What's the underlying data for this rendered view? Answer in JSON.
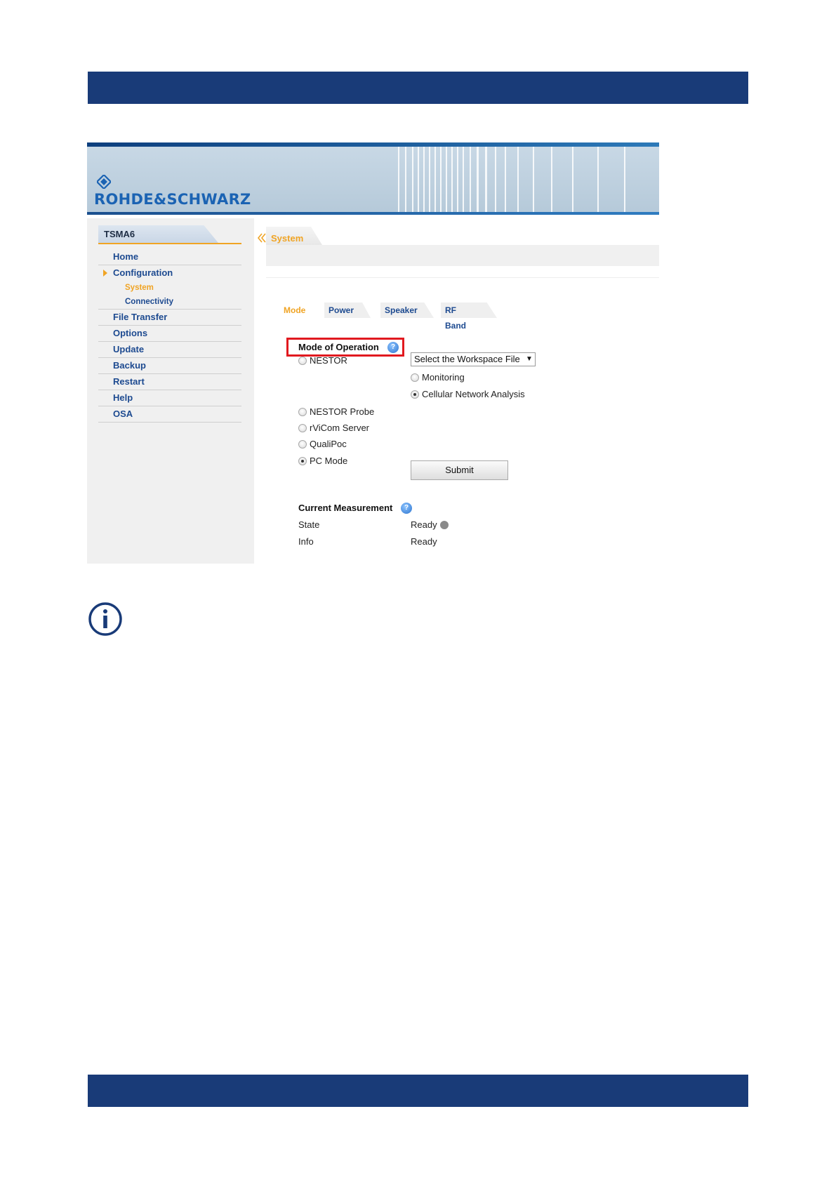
{
  "brand": {
    "logo_text": "ROHDE&SCHWARZ"
  },
  "device": {
    "name": "TSMA6"
  },
  "nav": {
    "home": "Home",
    "configuration": "Configuration",
    "system": "System",
    "connectivity": "Connectivity",
    "file_transfer": "File Transfer",
    "options": "Options",
    "update": "Update",
    "backup": "Backup",
    "restart": "Restart",
    "help": "Help",
    "osa": "OSA"
  },
  "section": {
    "title": "System"
  },
  "tabs": [
    {
      "label": "Mode",
      "active": true
    },
    {
      "label": "Power",
      "active": false
    },
    {
      "label": "Speaker",
      "active": false
    },
    {
      "label": "RF Band",
      "active": false
    }
  ],
  "mode_of_operation": {
    "heading": "Mode of Operation",
    "help_glyph": "?",
    "options": {
      "nestor": {
        "label": "NESTOR",
        "checked": false
      },
      "nestor_probe": {
        "label": "NESTOR Probe",
        "checked": false
      },
      "rvicom_server": {
        "label": "rViCom Server",
        "checked": false
      },
      "qualipoc": {
        "label": "QualiPoc",
        "checked": false
      },
      "pc_mode": {
        "label": "PC Mode",
        "checked": true
      }
    },
    "workspace_select": {
      "value": "Select the Workspace File",
      "arrow": "▼"
    },
    "sub_options": {
      "monitoring": {
        "label": "Monitoring",
        "checked": false
      },
      "cellular": {
        "label": "Cellular Network Analysis",
        "checked": true
      }
    },
    "submit_label": "Submit"
  },
  "current_measurement": {
    "heading": "Current Measurement",
    "state_label": "State",
    "state_value": "Ready",
    "info_label": "Info",
    "info_value": "Ready"
  },
  "colors": {
    "page_bar": "#193b78",
    "nav_text": "#1d4a90",
    "accent": "#f0a424",
    "highlight_box": "#e1191f"
  },
  "icons": {
    "help": "help-icon",
    "info": "info-icon",
    "collapse": "double-chevron-left-icon",
    "nav_arrow": "triangle-right-icon"
  }
}
